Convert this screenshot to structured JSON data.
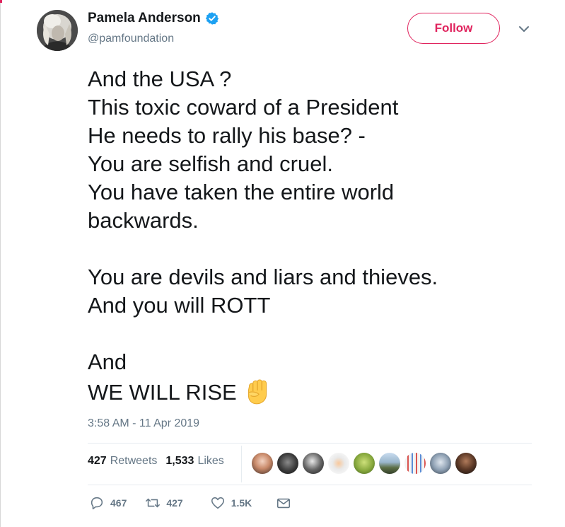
{
  "author": {
    "name": "Pamela Anderson",
    "handle": "@pamfoundation",
    "verified": true
  },
  "follow_label": "Follow",
  "tweet_lines": [
    "And the USA ?",
    "This toxic coward of a President",
    "He needs to rally his base? -",
    "You are selfish and cruel.",
    "You have taken the entire world",
    "backwards.",
    "",
    "You are devils and liars and thieves.",
    "And you will ROTT",
    "",
    "And",
    "WE WILL RISE"
  ],
  "emoji": "raised-fist",
  "timestamp": "3:58 AM - 11 Apr 2019",
  "stats": {
    "retweets_count": "427",
    "retweets_label": "Retweets",
    "likes_count": "1,533",
    "likes_label": "Likes"
  },
  "actions": {
    "reply_count": "467",
    "retweet_count": "427",
    "like_count": "1.5K"
  },
  "colors": {
    "accent": "#e0245e",
    "text": "#14171a",
    "muted": "#657786",
    "verified": "#1da1f2",
    "divider": "#e6ecf0"
  }
}
